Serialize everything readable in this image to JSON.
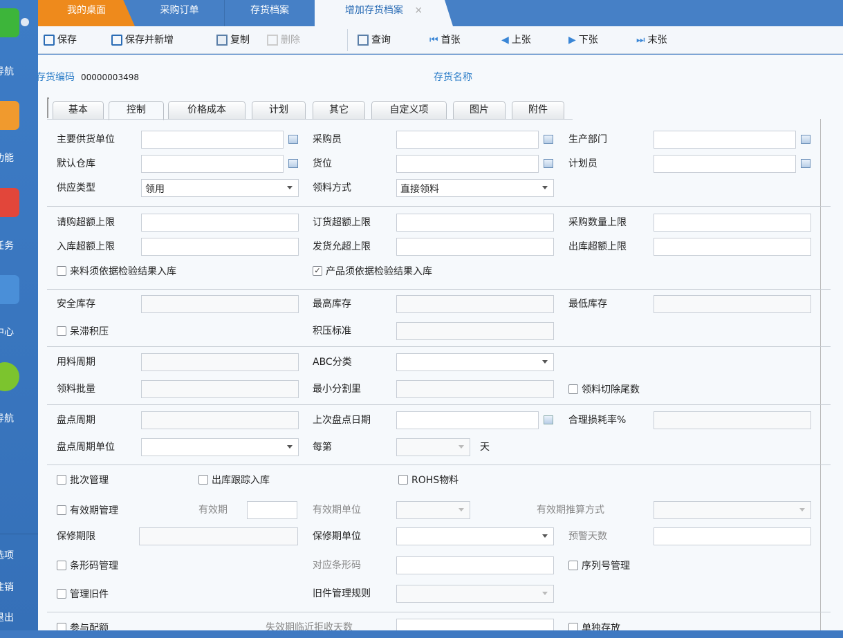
{
  "sidebar": {
    "items": [
      {
        "label": "导航",
        "color": "#3db53a"
      },
      {
        "label": "功能",
        "color": "#f09a2e"
      },
      {
        "label": "任务",
        "color": "#e2463a"
      },
      {
        "label": "中心",
        "color": "#4a8fd8"
      },
      {
        "label": "导航",
        "color": "#7cc42e"
      }
    ],
    "bottom": [
      "选项",
      "注销",
      "退出"
    ]
  },
  "tabs": [
    {
      "label": "我的桌面"
    },
    {
      "label": "采购订单"
    },
    {
      "label": "存货档案"
    },
    {
      "label": "增加存货档案",
      "close": "×"
    }
  ],
  "toolbar": {
    "save": "保存",
    "save_new": "保存并新增",
    "copy": "复制",
    "delete": "删除",
    "query": "查询",
    "first": "首张",
    "prev": "上张",
    "next": "下张",
    "last": "末张"
  },
  "header": {
    "code_label": "存货编码",
    "code_value": "00000003498",
    "name_label": "存货名称"
  },
  "form_tabs": [
    "基本",
    "控制",
    "价格成本",
    "计划",
    "其它",
    "自定义项",
    "图片",
    "附件"
  ],
  "active_form_tab": "控制",
  "form": {
    "main_supplier": "主要供货单位",
    "buyer": "采购员",
    "prod_dept": "生产部门",
    "default_wh": "默认仓库",
    "location": "货位",
    "planner": "计划员",
    "supply_type": "供应类型",
    "supply_type_value": "领用",
    "pick_method": "领料方式",
    "pick_method_value": "直接领料",
    "req_over": "请购超额上限",
    "order_over": "订货超额上限",
    "purchase_qty_limit": "采购数量上限",
    "in_over": "入库超额上限",
    "ship_over": "发货允超上限",
    "out_over": "出库超额上限",
    "incoming_inspect": {
      "label": "来料须依据检验结果入库",
      "checked": false
    },
    "product_inspect": {
      "label": "产品须依据检验结果入库",
      "checked": true
    },
    "safety_stock": "安全库存",
    "max_stock": "最高库存",
    "min_stock": "最低库存",
    "stagnant": {
      "label": "呆滞积压",
      "checked": false
    },
    "stagnant_std": "积压标准",
    "usage_period": "用料周期",
    "abc": "ABC分类",
    "pick_batch": "领料批量",
    "min_split": "最小分割里",
    "pick_cut": {
      "label": "领料切除尾数",
      "checked": false
    },
    "count_period": "盘点周期",
    "last_count_date": "上次盘点日期",
    "loss_rate": "合理损耗率%",
    "count_unit": "盘点周期单位",
    "every": "每第",
    "day": "天",
    "batch": {
      "label": "批次管理",
      "checked": false
    },
    "out_track": {
      "label": "出库跟踪入库",
      "checked": false
    },
    "rohs": {
      "label": "ROHS物料",
      "checked": false
    },
    "expiry_mgmt": {
      "label": "有效期管理",
      "checked": false
    },
    "expiry": "有效期",
    "expiry_unit": "有效期单位",
    "expiry_calc": "有效期推算方式",
    "warranty": "保修期限",
    "warranty_unit": "保修期单位",
    "warn_days": "预警天数",
    "barcode": {
      "label": "条形码管理",
      "checked": false
    },
    "barcode_map": "对应条形码",
    "serial": {
      "label": "序列号管理",
      "checked": false
    },
    "old_parts": {
      "label": "管理旧件",
      "checked": false
    },
    "old_rule": "旧件管理规则",
    "quota": {
      "label": "参与配额",
      "checked": false
    },
    "reject_days": "失效期临近拒收天数",
    "separate": {
      "label": "单独存放",
      "checked": false
    }
  }
}
